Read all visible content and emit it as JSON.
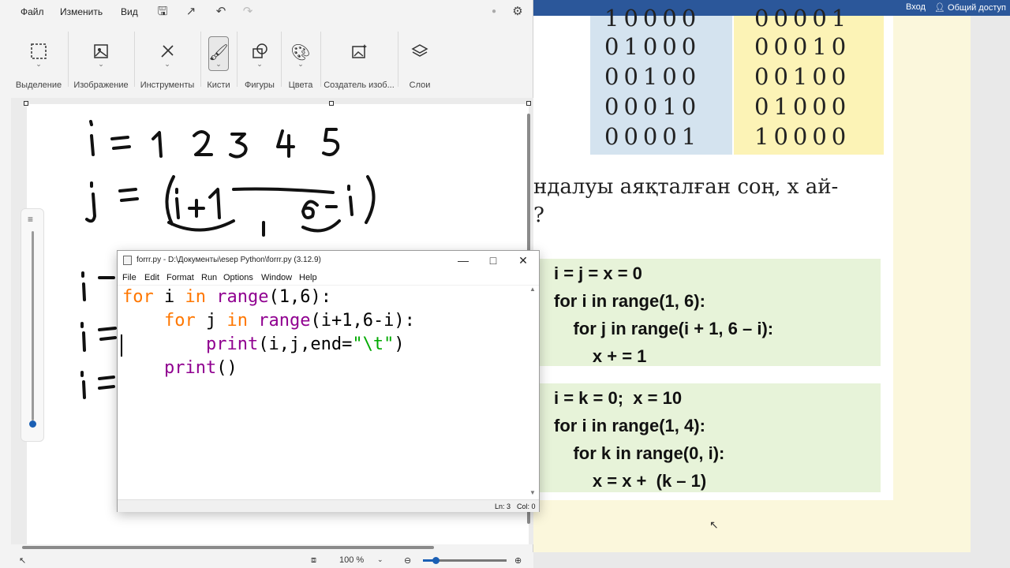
{
  "word": {
    "signin": "Вход",
    "share": "Общий доступ",
    "table": {
      "col1": [
        "10000",
        "01000",
        "00100",
        "00010",
        "00001"
      ],
      "col2": [
        "00001",
        "00010",
        "00100",
        "01000",
        "10000"
      ]
    },
    "text_line1": "ндалуы аяқталған соң, x ай-",
    "text_line2": "?",
    "code1": [
      "i = j = x = 0",
      "for i in range(1, 6):",
      "    for j in range(i + 1, 6 – i):",
      "        x + = 1"
    ],
    "code2": [
      "i = k = 0;  x = 10",
      "for i in range(1, 4):",
      "    for k in range(0, i):",
      "        x = x +  (k – 1)"
    ]
  },
  "paint": {
    "menu": [
      "Файл",
      "Изменить",
      "Вид"
    ],
    "ribbon": [
      "Выделение",
      "Изображение",
      "Инструменты",
      "Кисти",
      "Фигуры",
      "Цвета",
      "Создатель изоб...",
      "Слои"
    ],
    "zoom": "100 %",
    "zoom_level_fraction": 0.15
  },
  "idle": {
    "title": "forrr.py - D:\\Документы\\esep Python\\forrr.py (3.12.9)",
    "menu": [
      "File",
      "Edit",
      "Format",
      "Run",
      "Options",
      "Window",
      "Help"
    ],
    "ln": "Ln: 3",
    "col": "Col: 0"
  }
}
